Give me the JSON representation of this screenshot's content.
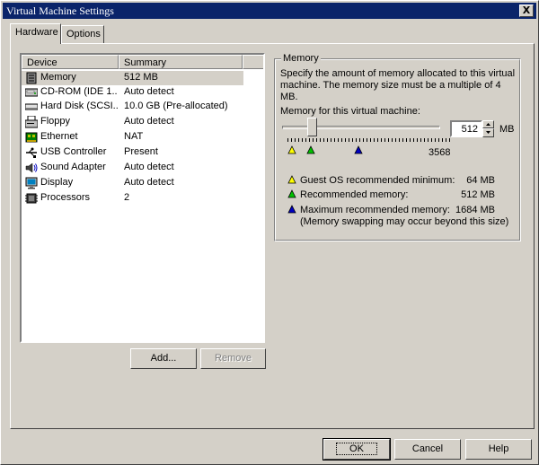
{
  "window": {
    "title": "Virtual Machine Settings",
    "close_glyph": "X"
  },
  "tabs": [
    {
      "label": "Hardware",
      "active": true
    },
    {
      "label": "Options",
      "active": false
    }
  ],
  "device_list": {
    "columns": [
      "Device",
      "Summary"
    ],
    "rows": [
      {
        "device": "Memory",
        "summary": "512 MB",
        "icon": "memory-icon",
        "selected": true
      },
      {
        "device": "CD-ROM (IDE 1...",
        "summary": "Auto detect",
        "icon": "cdrom-icon"
      },
      {
        "device": "Hard Disk (SCSI...",
        "summary": "10.0 GB (Pre-allocated)",
        "icon": "hard-disk-icon"
      },
      {
        "device": "Floppy",
        "summary": "Auto detect",
        "icon": "floppy-icon"
      },
      {
        "device": "Ethernet",
        "summary": "NAT",
        "icon": "ethernet-icon"
      },
      {
        "device": "USB Controller",
        "summary": "Present",
        "icon": "usb-controller-icon"
      },
      {
        "device": "Sound Adapter",
        "summary": "Auto detect",
        "icon": "sound-adapter-icon"
      },
      {
        "device": "Display",
        "summary": "Auto detect",
        "icon": "display-icon"
      },
      {
        "device": "Processors",
        "summary": "2",
        "icon": "processors-icon"
      }
    ]
  },
  "list_buttons": {
    "add": "Add...",
    "remove": "Remove"
  },
  "memory": {
    "group_label": "Memory",
    "description": "Specify the amount of memory allocated to this virtual machine. The memory size must be a multiple of 4 MB.",
    "slider_label": "Memory for this virtual machine:",
    "value": "512",
    "unit": "MB",
    "slider_max_label": "3568",
    "slider_position_mb": 512,
    "legend": [
      {
        "color": "#ffff00",
        "label": "Guest OS recommended minimum:",
        "value": "64 MB"
      },
      {
        "color": "#00c000",
        "label": "Recommended memory:",
        "value": "512 MB"
      },
      {
        "color": "#0000c0",
        "label": "Maximum recommended memory:",
        "value": "1684 MB"
      }
    ],
    "note": "(Memory swapping may occur beyond this size)"
  },
  "dialog_buttons": {
    "ok": "OK",
    "cancel": "Cancel",
    "help": "Help"
  }
}
